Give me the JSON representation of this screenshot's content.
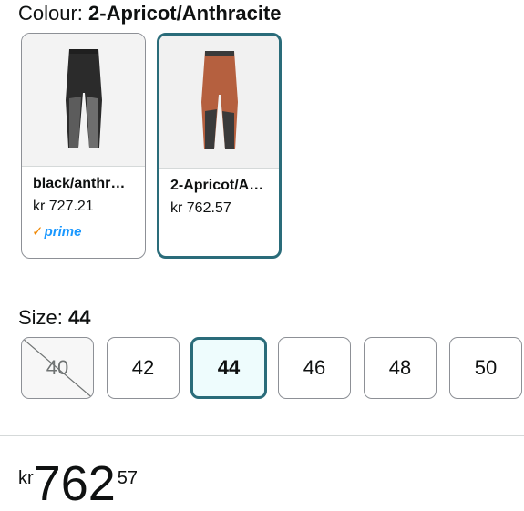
{
  "colour": {
    "label": "Colour:",
    "selected": "2-Apricot/Anthracite",
    "options": [
      {
        "name": "black/anthr…",
        "price": "kr 727.21",
        "prime": "prime",
        "selected": false,
        "color": "#2b2b2b",
        "accent": "#6e6e6e"
      },
      {
        "name": "2-Apricot/A…",
        "price": "kr 762.57",
        "selected": true,
        "color": "#b5603f",
        "accent": "#3a3a3a"
      }
    ]
  },
  "size": {
    "label": "Size:",
    "selected": "44",
    "options": [
      {
        "label": "40",
        "available": false
      },
      {
        "label": "42",
        "available": true
      },
      {
        "label": "44",
        "available": true,
        "selected": true
      },
      {
        "label": "46",
        "available": true
      },
      {
        "label": "48",
        "available": true
      },
      {
        "label": "50",
        "available": true
      }
    ]
  },
  "price": {
    "currency": "kr",
    "whole": "762",
    "fraction": "57"
  },
  "colors": {
    "selected_border": "#2a6c7a",
    "selected_bg": "#eefcfd",
    "prime_blue": "#1a98ff",
    "prime_check": "#f08804"
  }
}
